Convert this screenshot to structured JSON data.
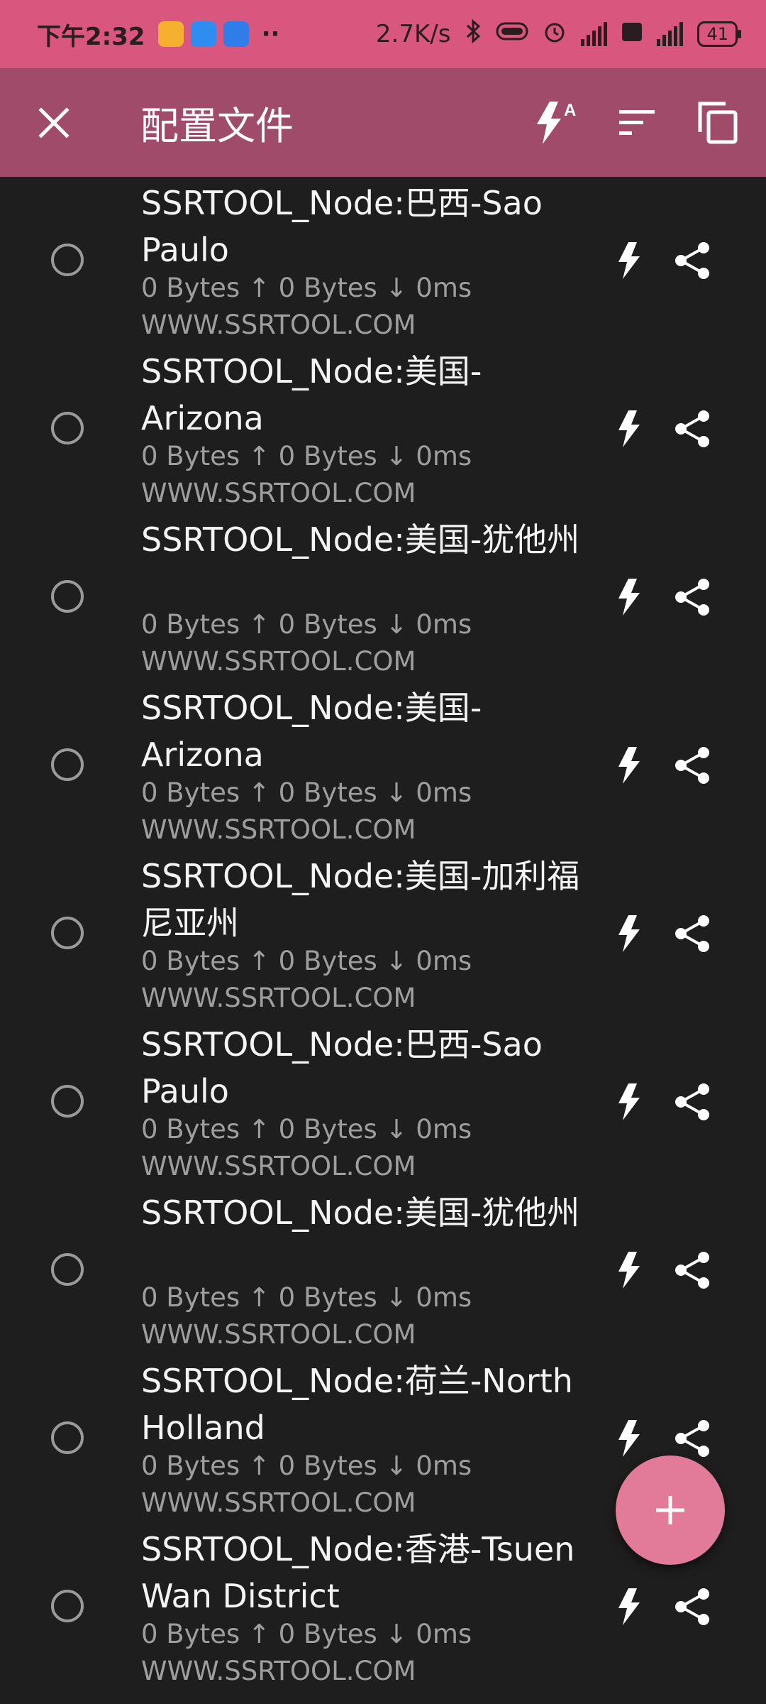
{
  "status_bar": {
    "time": "下午2:32",
    "dots": "··",
    "net_speed": "2.7K/s",
    "battery": "41",
    "colors": {
      "bg": "#d9567f"
    }
  },
  "app_bar": {
    "title": "配置文件",
    "icons": [
      "close-icon",
      "test-all-icon",
      "sort-icon",
      "copy-icon"
    ],
    "colors": {
      "bg": "#a14b6b"
    }
  },
  "profiles": [
    {
      "name": "SSRTOOL_Node:巴西-Sao Paulo",
      "stats": "0 Bytes ↑ 0 Bytes ↓ 0ms",
      "host": "WWW.SSRTOOL.COM"
    },
    {
      "name": "SSRTOOL_Node:美国-Arizona",
      "stats": "0 Bytes ↑ 0 Bytes ↓ 0ms",
      "host": "WWW.SSRTOOL.COM"
    },
    {
      "name": "SSRTOOL_Node:美国-犹他州",
      "stats": "0 Bytes ↑ 0 Bytes ↓ 0ms",
      "host": "WWW.SSRTOOL.COM"
    },
    {
      "name": "SSRTOOL_Node:美国-Arizona",
      "stats": "0 Bytes ↑ 0 Bytes ↓ 0ms",
      "host": "WWW.SSRTOOL.COM"
    },
    {
      "name": "SSRTOOL_Node:美国-加利福尼亚州",
      "stats": "0 Bytes ↑ 0 Bytes ↓ 0ms",
      "host": "WWW.SSRTOOL.COM"
    },
    {
      "name": "SSRTOOL_Node:巴西-Sao Paulo",
      "stats": "0 Bytes ↑ 0 Bytes ↓ 0ms",
      "host": "WWW.SSRTOOL.COM"
    },
    {
      "name": "SSRTOOL_Node:美国-犹他州",
      "stats": "0 Bytes ↑ 0 Bytes ↓ 0ms",
      "host": "WWW.SSRTOOL.COM"
    },
    {
      "name": "SSRTOOL_Node:荷兰-North Holland",
      "stats": "0 Bytes ↑ 0 Bytes ↓ 0ms",
      "host": "WWW.SSRTOOL.COM"
    },
    {
      "name": "SSRTOOL_Node:香港-Tsuen Wan District",
      "stats": "0 Bytes ↑ 0 Bytes ↓ 0ms",
      "host": "WWW.SSRTOOL.COM"
    }
  ],
  "fab": {
    "label": "+",
    "colors": {
      "bg": "#e27a9a"
    }
  }
}
